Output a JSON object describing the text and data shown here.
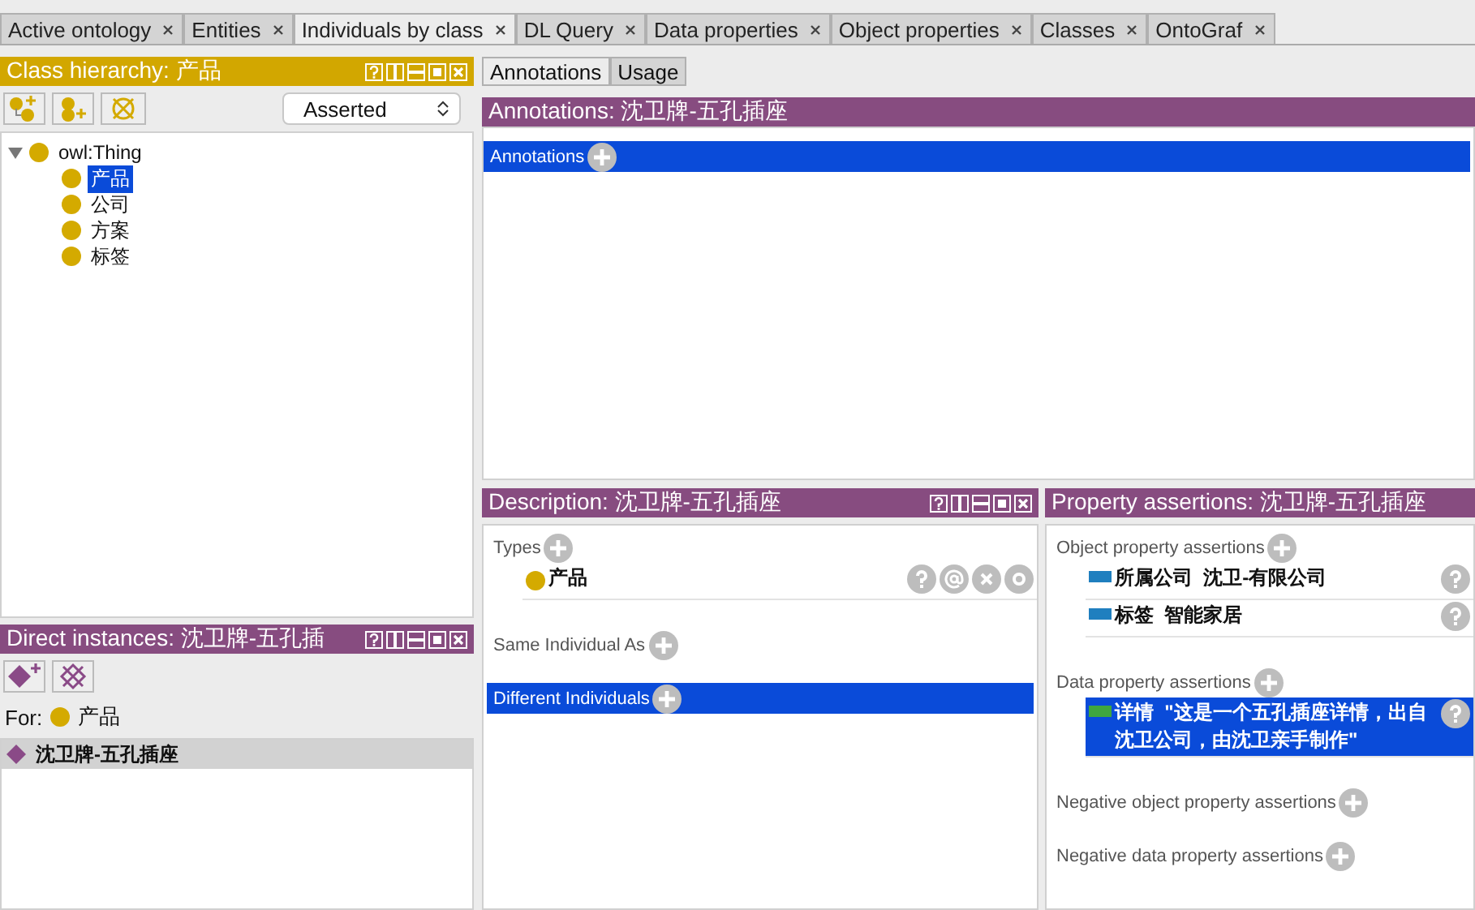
{
  "tabs": [
    {
      "label": "Active ontology",
      "selected": false
    },
    {
      "label": "Entities",
      "selected": false
    },
    {
      "label": "Individuals by class",
      "selected": true
    },
    {
      "label": "DL Query",
      "selected": false
    },
    {
      "label": "Data properties",
      "selected": false
    },
    {
      "label": "Object properties",
      "selected": false
    },
    {
      "label": "Classes",
      "selected": false
    },
    {
      "label": "OntoGraf",
      "selected": false
    }
  ],
  "class_hierarchy": {
    "title": "Class hierarchy: 产品",
    "dropdown": "Asserted",
    "tree": [
      {
        "label": "owl:Thing",
        "selected": false,
        "expanded": true,
        "children": [
          {
            "label": "产品",
            "selected": true
          },
          {
            "label": "公司",
            "selected": false
          },
          {
            "label": "方案",
            "selected": false
          },
          {
            "label": "标签",
            "selected": false
          }
        ]
      }
    ]
  },
  "direct_instances": {
    "title": "Direct instances: 沈卫牌-五孔插",
    "for_label": "For:",
    "for_class": "产品",
    "items": [
      {
        "label": "沈卫牌-五孔插座",
        "selected": true
      }
    ]
  },
  "view_tabs": [
    {
      "label": "Annotations",
      "selected": true
    },
    {
      "label": "Usage",
      "selected": false
    }
  ],
  "annotations": {
    "title": "Annotations: 沈卫牌-五孔插座",
    "sections": [
      {
        "label": "Annotations",
        "selected": true
      }
    ]
  },
  "description": {
    "title": "Description: 沈卫牌-五孔插座",
    "sections": [
      {
        "label": "Types",
        "selected": false,
        "items": [
          {
            "kind": "class",
            "label": "产品",
            "selected": false
          }
        ]
      },
      {
        "label": "Same Individual As",
        "selected": false
      },
      {
        "label": "Different Individuals",
        "selected": true
      }
    ]
  },
  "property_assertions": {
    "title": "Property assertions: 沈卫牌-五孔插座",
    "sections": [
      {
        "label": "Object property assertions",
        "selected": false,
        "items": [
          {
            "kind": "object",
            "property": "所属公司",
            "value": "沈卫-有限公司",
            "selected": false
          },
          {
            "kind": "object",
            "property": "标签",
            "value": "智能家居",
            "selected": false
          }
        ]
      },
      {
        "label": "Data property assertions",
        "selected": false,
        "items": [
          {
            "kind": "data",
            "property": "详情",
            "value": "\"这是一个五孔插座详情，出自沈卫公司，由沈卫亲手制作\"",
            "selected": true
          }
        ]
      },
      {
        "label": "Negative object property assertions",
        "selected": false
      },
      {
        "label": "Negative data property assertions",
        "selected": false
      }
    ]
  }
}
